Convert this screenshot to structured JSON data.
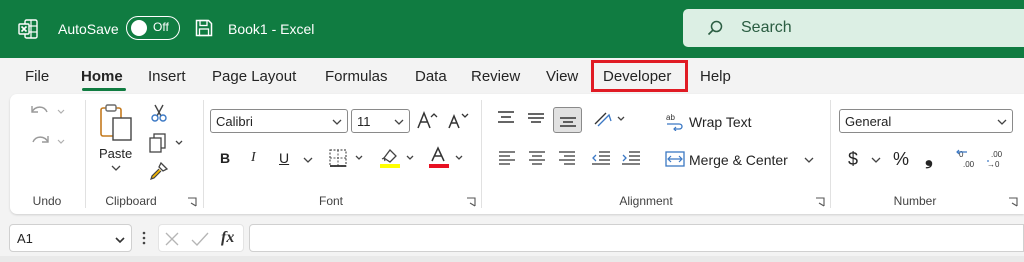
{
  "titlebar": {
    "autosave_label": "AutoSave",
    "autosave_state": "Off",
    "workbook_title": "Book1  -  Excel",
    "search_placeholder": "Search",
    "brand_color": "#107c41"
  },
  "tabs": [
    {
      "label": "File"
    },
    {
      "label": "Home",
      "active": true
    },
    {
      "label": "Insert"
    },
    {
      "label": "Page Layout"
    },
    {
      "label": "Formulas"
    },
    {
      "label": "Data"
    },
    {
      "label": "Review"
    },
    {
      "label": "View"
    },
    {
      "label": "Developer",
      "highlighted": true,
      "highlight_color": "#e01b24"
    },
    {
      "label": "Help"
    }
  ],
  "ribbon": {
    "undo": {
      "group_label": "Undo"
    },
    "clipboard": {
      "group_label": "Clipboard",
      "paste_label": "Paste"
    },
    "font": {
      "group_label": "Font",
      "font_name": "Calibri",
      "font_size": "11",
      "bold": "B",
      "italic": "I",
      "underline": "U",
      "highlight_color": "#ffff00",
      "font_color": "#e81123"
    },
    "alignment": {
      "group_label": "Alignment",
      "wrap_text_label": "Wrap Text",
      "merge_center_label": "Merge & Center"
    },
    "number": {
      "group_label": "Number",
      "format_value": "General",
      "currency_symbol": "$",
      "percent_symbol": "%",
      "comma_symbol": "❟"
    }
  },
  "formula_bar": {
    "name_box_value": "A1",
    "fx_label": "fx",
    "formula_value": ""
  }
}
